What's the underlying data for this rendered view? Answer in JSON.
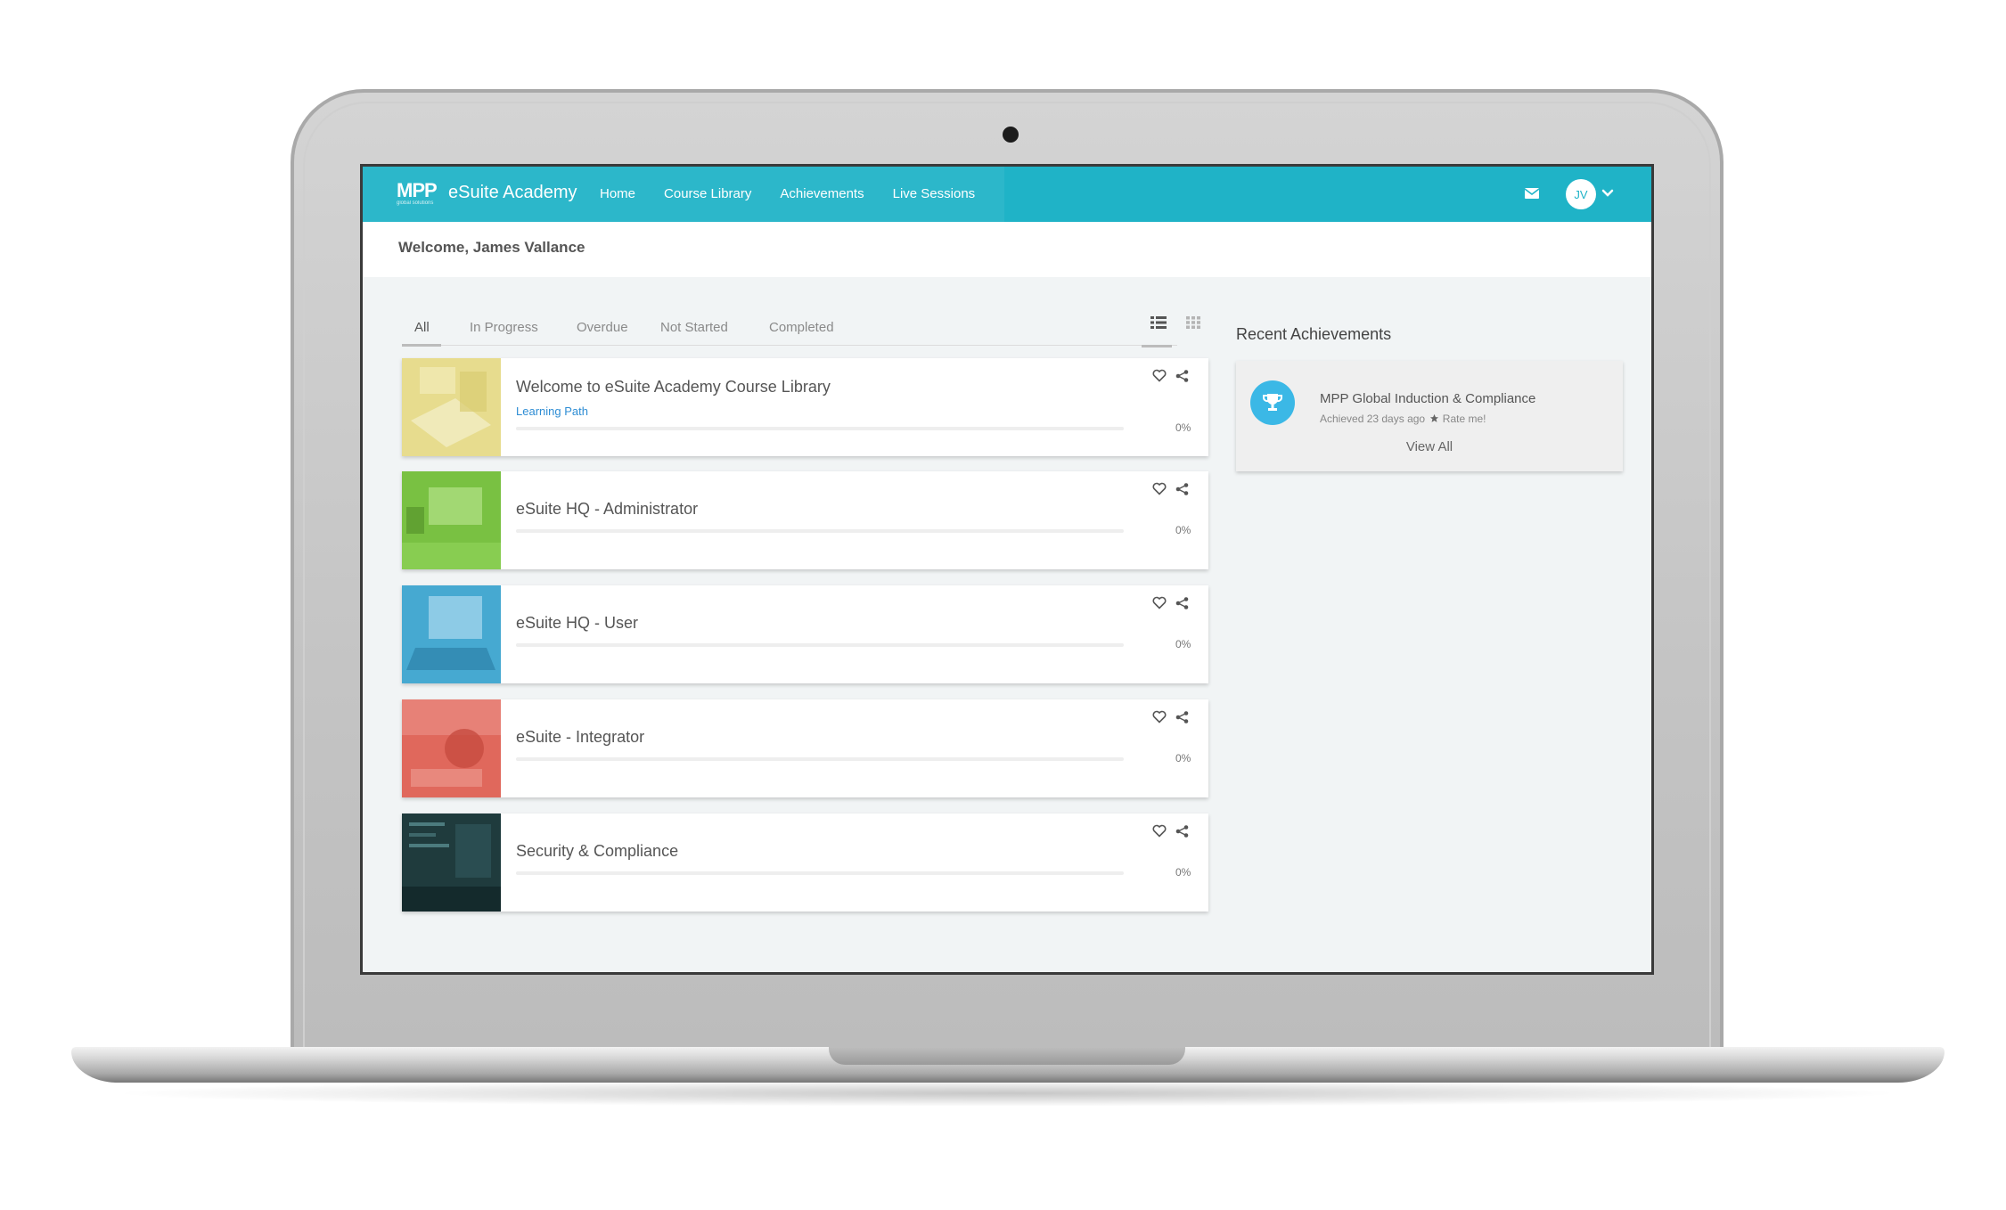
{
  "header": {
    "logo_text": "MPP",
    "logo_subtext": "global solutions",
    "brand": "eSuite Academy",
    "nav": [
      "Home",
      "Course Library",
      "Achievements",
      "Live Sessions"
    ],
    "avatar_initials": "JV"
  },
  "welcome": "Welcome, James Vallance",
  "tabs": [
    "All",
    "In Progress",
    "Overdue",
    "Not Started",
    "Completed"
  ],
  "active_tab": "All",
  "courses": [
    {
      "title": "Welcome to eSuite Academy Course Library",
      "subtitle": "Learning Path",
      "progress_text": "0%",
      "progress": 0,
      "thumb_color": "#e7dc8e"
    },
    {
      "title": "eSuite HQ - Administrator",
      "progress_text": "0%",
      "progress": 0,
      "thumb_color": "#79c142"
    },
    {
      "title": "eSuite HQ - User",
      "progress_text": "0%",
      "progress": 0,
      "thumb_color": "#46a9d1"
    },
    {
      "title": "eSuite - Integrator",
      "progress_text": "0%",
      "progress": 0,
      "thumb_color": "#e0685c"
    },
    {
      "title": "Security & Compliance",
      "progress_text": "0%",
      "progress": 0,
      "thumb_color": "#1f3b3d"
    }
  ],
  "achievements": {
    "title": "Recent Achievements",
    "item_name": "MPP Global Induction & Compliance",
    "item_meta": "Achieved 23 days ago",
    "rate_label": "Rate me!",
    "view_all": "View All"
  },
  "colors": {
    "accent": "#1fb3c7",
    "link": "#2e8dd4",
    "trophy": "#3bb8e6"
  },
  "icons": [
    "mail-icon",
    "chevron-down-icon",
    "list-view-icon",
    "grid-view-icon",
    "heart-icon",
    "share-icon",
    "trophy-icon",
    "star-icon"
  ]
}
